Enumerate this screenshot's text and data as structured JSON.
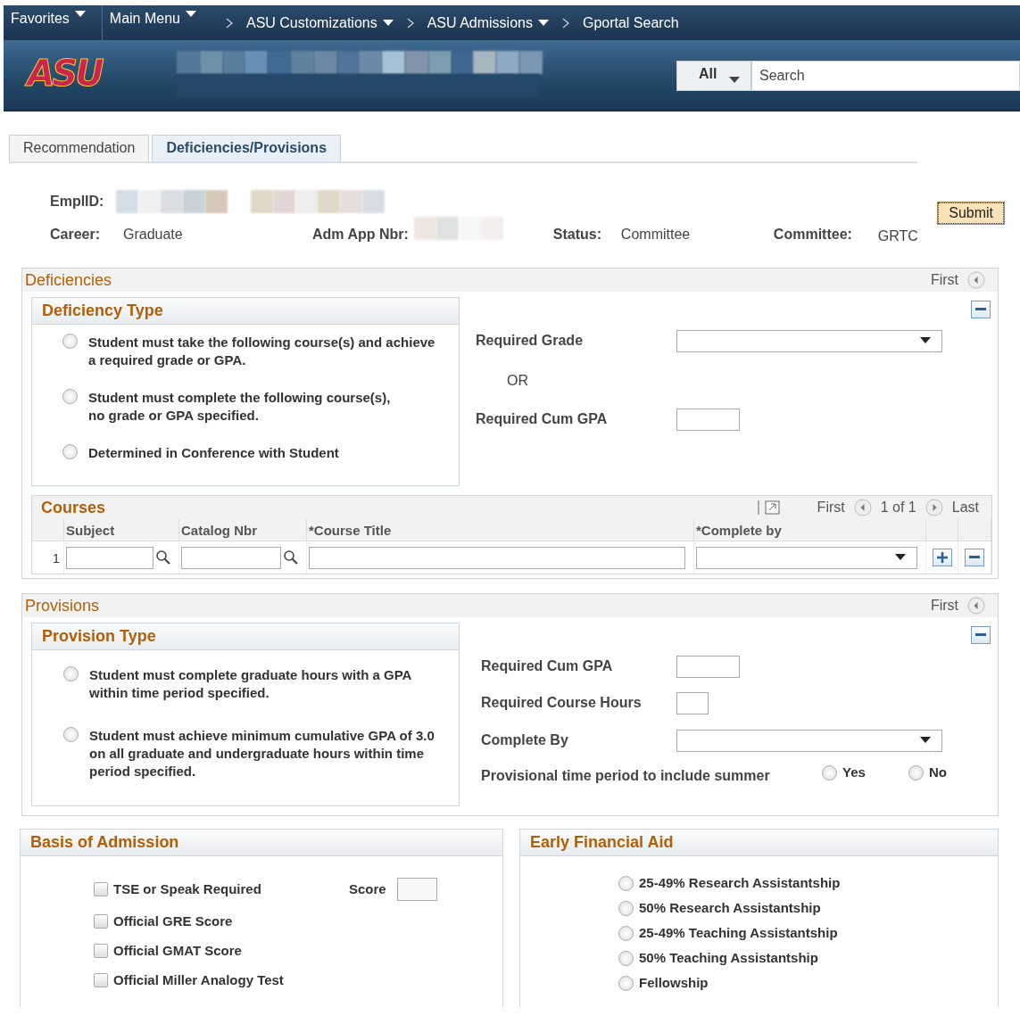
{
  "nav": {
    "menus": [
      {
        "label": "Favorites",
        "has_dropdown": true
      },
      {
        "label": "Main Menu",
        "has_dropdown": true
      }
    ],
    "breadcrumbs": [
      {
        "label": "ASU Customizations",
        "has_dropdown": true
      },
      {
        "label": "ASU Admissions",
        "has_dropdown": true
      },
      {
        "label": "Gportal Search",
        "has_dropdown": false
      }
    ]
  },
  "banner": {
    "logo": "ASU",
    "search": {
      "scope": "All",
      "placeholder": "Search"
    }
  },
  "tabs": [
    {
      "label": "Recommendation",
      "selected": false
    },
    {
      "label": "Deficiencies/Provisions",
      "selected": true
    }
  ],
  "submit": "Submit",
  "header": {
    "emplid_label": "EmplID:",
    "career_label": "Career:",
    "career": "Graduate",
    "adm_app_label": "Adm App Nbr:",
    "status_label": "Status:",
    "status": "Committee",
    "committee_label": "Committee:",
    "committee": "GRTC"
  },
  "deficiencies": {
    "title": "Deficiencies",
    "first": "First",
    "type_title": "Deficiency Type",
    "options": [
      {
        "label": "Student must take the following course(s) and achieve a required grade or GPA.",
        "selected": false
      },
      {
        "label": "Student must complete the following course(s), no grade or GPA specified.",
        "selected": false
      },
      {
        "label": "Determined in Conference with Student",
        "selected": false
      }
    ],
    "required_grade": "Required Grade",
    "or": "OR",
    "required_cum_gpa": "Required Cum GPA",
    "courses": {
      "title": "Courses",
      "first": "First",
      "range": "1 of 1",
      "last": "Last",
      "columns": [
        "Subject",
        "Catalog Nbr",
        "*Course Title",
        "*Complete by"
      ],
      "rows": [
        {
          "number": "1"
        }
      ]
    }
  },
  "provisions": {
    "title": "Provisions",
    "first": "First",
    "type_title": "Provision Type",
    "options": [
      {
        "label": "Student must complete graduate hours with a GPA within time period specified.",
        "selected": false
      },
      {
        "label": "Student must achieve minimum cumulative GPA of 3.0 on all graduate and undergraduate hours within time period specified.",
        "selected": false
      }
    ],
    "required_cum_gpa": "Required Cum GPA",
    "required_course_hours": "Required Course Hours",
    "complete_by": "Complete By",
    "summer_label": "Provisional time period to include summer",
    "summer_options": [
      {
        "label": "Yes",
        "selected": false
      },
      {
        "label": "No",
        "selected": false
      }
    ]
  },
  "basis": {
    "title": "Basis of Admission",
    "score_label": "Score",
    "items": [
      {
        "label": "TSE or Speak Required",
        "checked": false
      },
      {
        "label": "Official GRE Score",
        "checked": false
      },
      {
        "label": "Official GMAT Score",
        "checked": false
      },
      {
        "label": "Official Miller Analogy Test",
        "checked": false
      }
    ]
  },
  "aid": {
    "title": "Early Financial Aid",
    "options": [
      {
        "label": "25-49% Research Assistantship",
        "selected": false
      },
      {
        "label": "50% Research Assistantship",
        "selected": false
      },
      {
        "label": "25-49% Teaching Assistantship",
        "selected": false
      },
      {
        "label": "50% Teaching Assistantship",
        "selected": false
      },
      {
        "label": "Fellowship",
        "selected": false
      }
    ]
  }
}
